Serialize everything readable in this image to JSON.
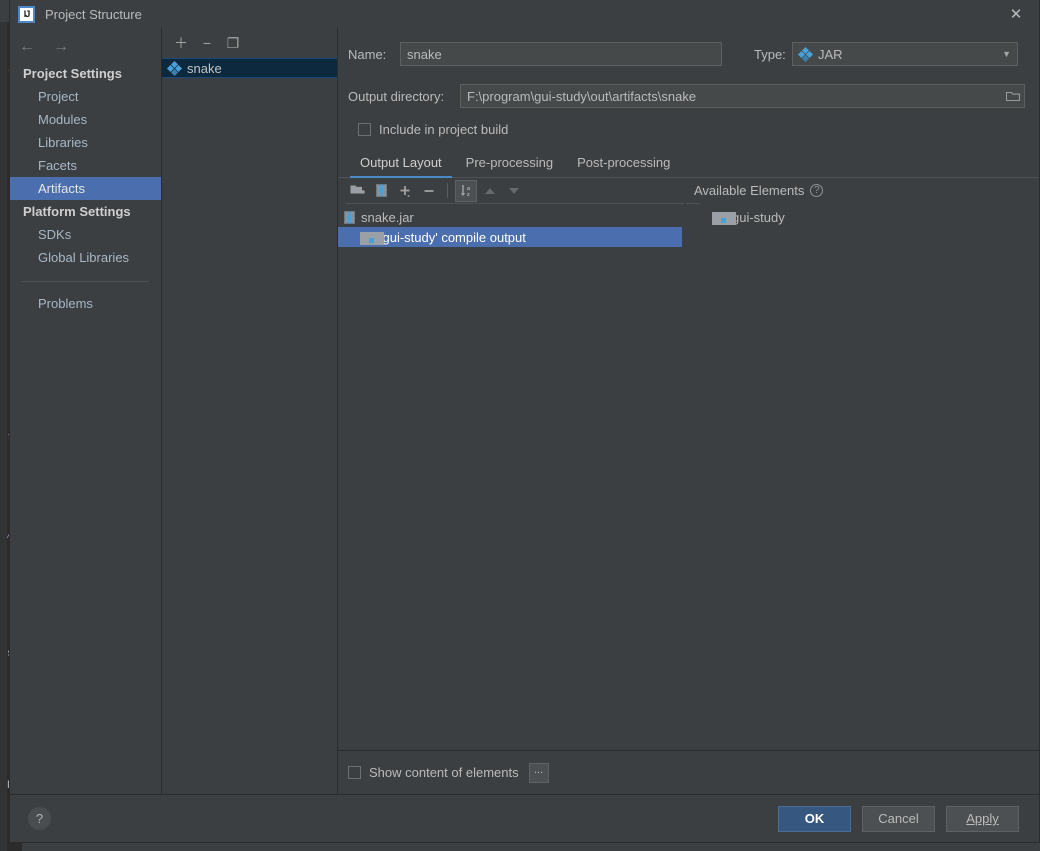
{
  "window": {
    "title": "Project Structure",
    "app_icon": "intellij-idea-icon",
    "close_label": "✕"
  },
  "nav": {
    "back_label": "←",
    "forward_label": "→"
  },
  "sidebar": {
    "groups": [
      {
        "title": "Project Settings",
        "items": [
          {
            "label": "Project",
            "selected": false
          },
          {
            "label": "Modules",
            "selected": false
          },
          {
            "label": "Libraries",
            "selected": false
          },
          {
            "label": "Facets",
            "selected": false
          },
          {
            "label": "Artifacts",
            "selected": true
          }
        ]
      },
      {
        "title": "Platform Settings",
        "items": [
          {
            "label": "SDKs",
            "selected": false
          },
          {
            "label": "Global Libraries",
            "selected": false
          }
        ]
      }
    ],
    "extra_items": [
      {
        "label": "Problems",
        "selected": false
      }
    ]
  },
  "artifact_panel": {
    "toolbar": [
      {
        "name": "add-artifact-button",
        "glyph": "＋"
      },
      {
        "name": "remove-artifact-button",
        "glyph": "−"
      },
      {
        "name": "copy-artifact-button",
        "glyph": "❐"
      }
    ],
    "items": [
      {
        "label": "snake",
        "icon": "artifact-icon",
        "selected": true
      }
    ]
  },
  "details": {
    "name_label": "Name:",
    "name_value": "snake",
    "name_placeholder": "",
    "type_label": "Type:",
    "type_value": "JAR",
    "type_icon": "artifact-icon",
    "output_dir_label": "Output directory:",
    "output_dir_value": "F:\\program\\gui-study\\out\\artifacts\\snake",
    "output_dir_placeholder": "",
    "browse_glyph": "🗁",
    "include_in_build_label": "Include in project build",
    "include_in_build_checked": false
  },
  "tabs": [
    {
      "label": "Output Layout",
      "active": true
    },
    {
      "label": "Pre-processing",
      "active": false
    },
    {
      "label": "Post-processing",
      "active": false
    }
  ],
  "layout_toolbar": [
    {
      "name": "create-directory-button",
      "glyph": "📁"
    },
    {
      "name": "create-archive-button",
      "glyph": "▤"
    },
    {
      "name": "add-element-button",
      "glyph": "＋"
    },
    {
      "name": "remove-element-button",
      "glyph": "−"
    },
    {
      "name": "sort-elements-button",
      "glyph": "↓"
    },
    {
      "name": "move-up-button",
      "glyph": "▲"
    },
    {
      "name": "move-down-button",
      "glyph": "▼"
    }
  ],
  "output_layout_tree": [
    {
      "label": "snake.jar",
      "icon": "jar-icon",
      "indent": 0,
      "selected": false
    },
    {
      "label": "'gui-study' compile output",
      "icon": "module-output-icon",
      "indent": 1,
      "selected": true
    }
  ],
  "available_elements": {
    "title": "Available Elements",
    "help_glyph": "?",
    "items": [
      {
        "label": "gui-study",
        "icon": "module-output-icon"
      }
    ]
  },
  "content_bottom": {
    "show_content_label": "Show content of elements",
    "show_content_checked": false,
    "dots_label": "..."
  },
  "footer": {
    "help_glyph": "?",
    "buttons": [
      {
        "label": "OK",
        "primary": true,
        "name": "ok-button"
      },
      {
        "label": "Cancel",
        "primary": false,
        "name": "cancel-button"
      },
      {
        "label": "Apply",
        "primary": false,
        "name": "apply-button"
      }
    ]
  },
  "colors": {
    "dialog_bg": "#3c3f41",
    "selection_blue": "#4b6eaf",
    "accent_blue": "#4a88c7",
    "primary_button": "#365880",
    "text": "#bbbbbb",
    "editor_bg": "#2b2b2b"
  }
}
